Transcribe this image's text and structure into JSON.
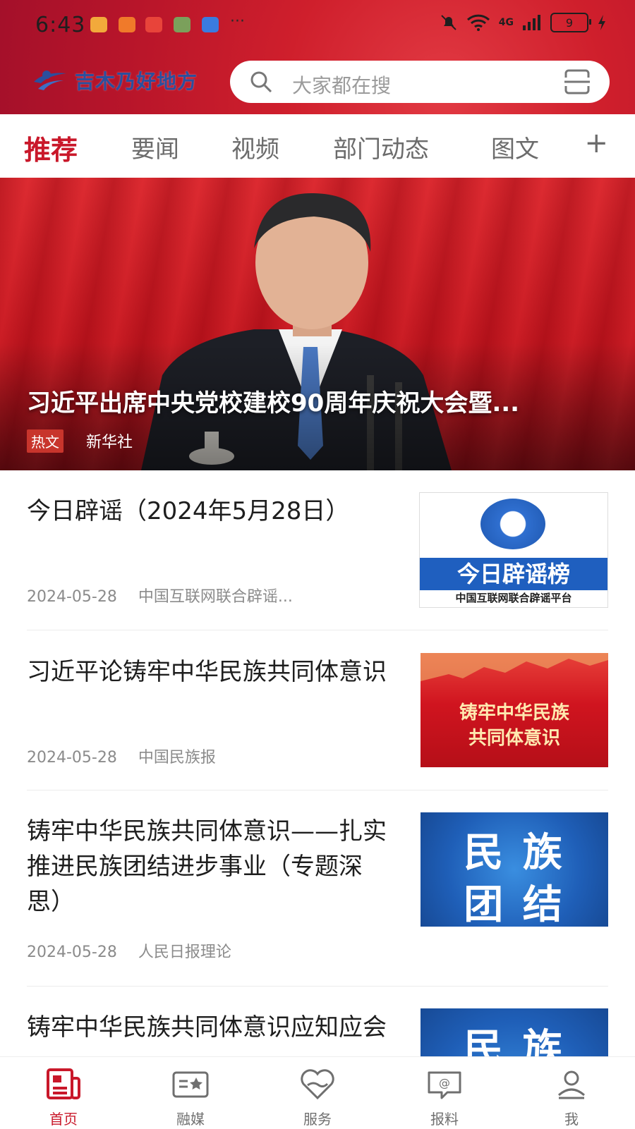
{
  "status": {
    "time": "6:43",
    "network": "4G",
    "battery": "9",
    "more": "···"
  },
  "header": {
    "logo_text": "吉木乃好地方",
    "search_placeholder": "大家都在搜"
  },
  "tabs": [
    {
      "label": "推荐"
    },
    {
      "label": "要闻"
    },
    {
      "label": "视频"
    },
    {
      "label": "部门动态"
    },
    {
      "label": "图文"
    }
  ],
  "tab_add": "+",
  "hero": {
    "title": "习近平出席中央党校建校90周年庆祝大会暨...",
    "tag": "热文",
    "source": "新华社"
  },
  "articles": [
    {
      "title": "今日辟谣（2024年5月28日）",
      "date": "2024-05-28",
      "source": "中国互联网联合辟谣...",
      "thumb_main": "今日辟谣榜",
      "thumb_sub": "中国互联网联合辟谣平台"
    },
    {
      "title": "习近平论铸牢中华民族共同体意识",
      "date": "2024-05-28",
      "source": "中国民族报",
      "thumb_line1": "铸牢中华民族",
      "thumb_line2": "共同体意识"
    },
    {
      "title": "铸牢中华民族共同体意识——扎实推进民族团结进步事业（专题深思）",
      "date": "2024-05-28",
      "source": "人民日报理论",
      "thumb_line1": "民 族",
      "thumb_line2": "团 结"
    },
    {
      "title": "铸牢中华民族共同体意识应知应会",
      "thumb_line1": "民 族"
    }
  ],
  "bottom_nav": [
    {
      "label": "首页",
      "icon": "newspaper-icon"
    },
    {
      "label": "融媒",
      "icon": "media-card-icon"
    },
    {
      "label": "服务",
      "icon": "heart-service-icon"
    },
    {
      "label": "报料",
      "icon": "report-chat-icon"
    },
    {
      "label": "我",
      "icon": "user-icon"
    }
  ],
  "colors": {
    "brand_red": "#c9182a",
    "header_red": "#cf1f2c",
    "text_dark": "#1e1e1e",
    "text_gray": "#8b8b8b"
  }
}
